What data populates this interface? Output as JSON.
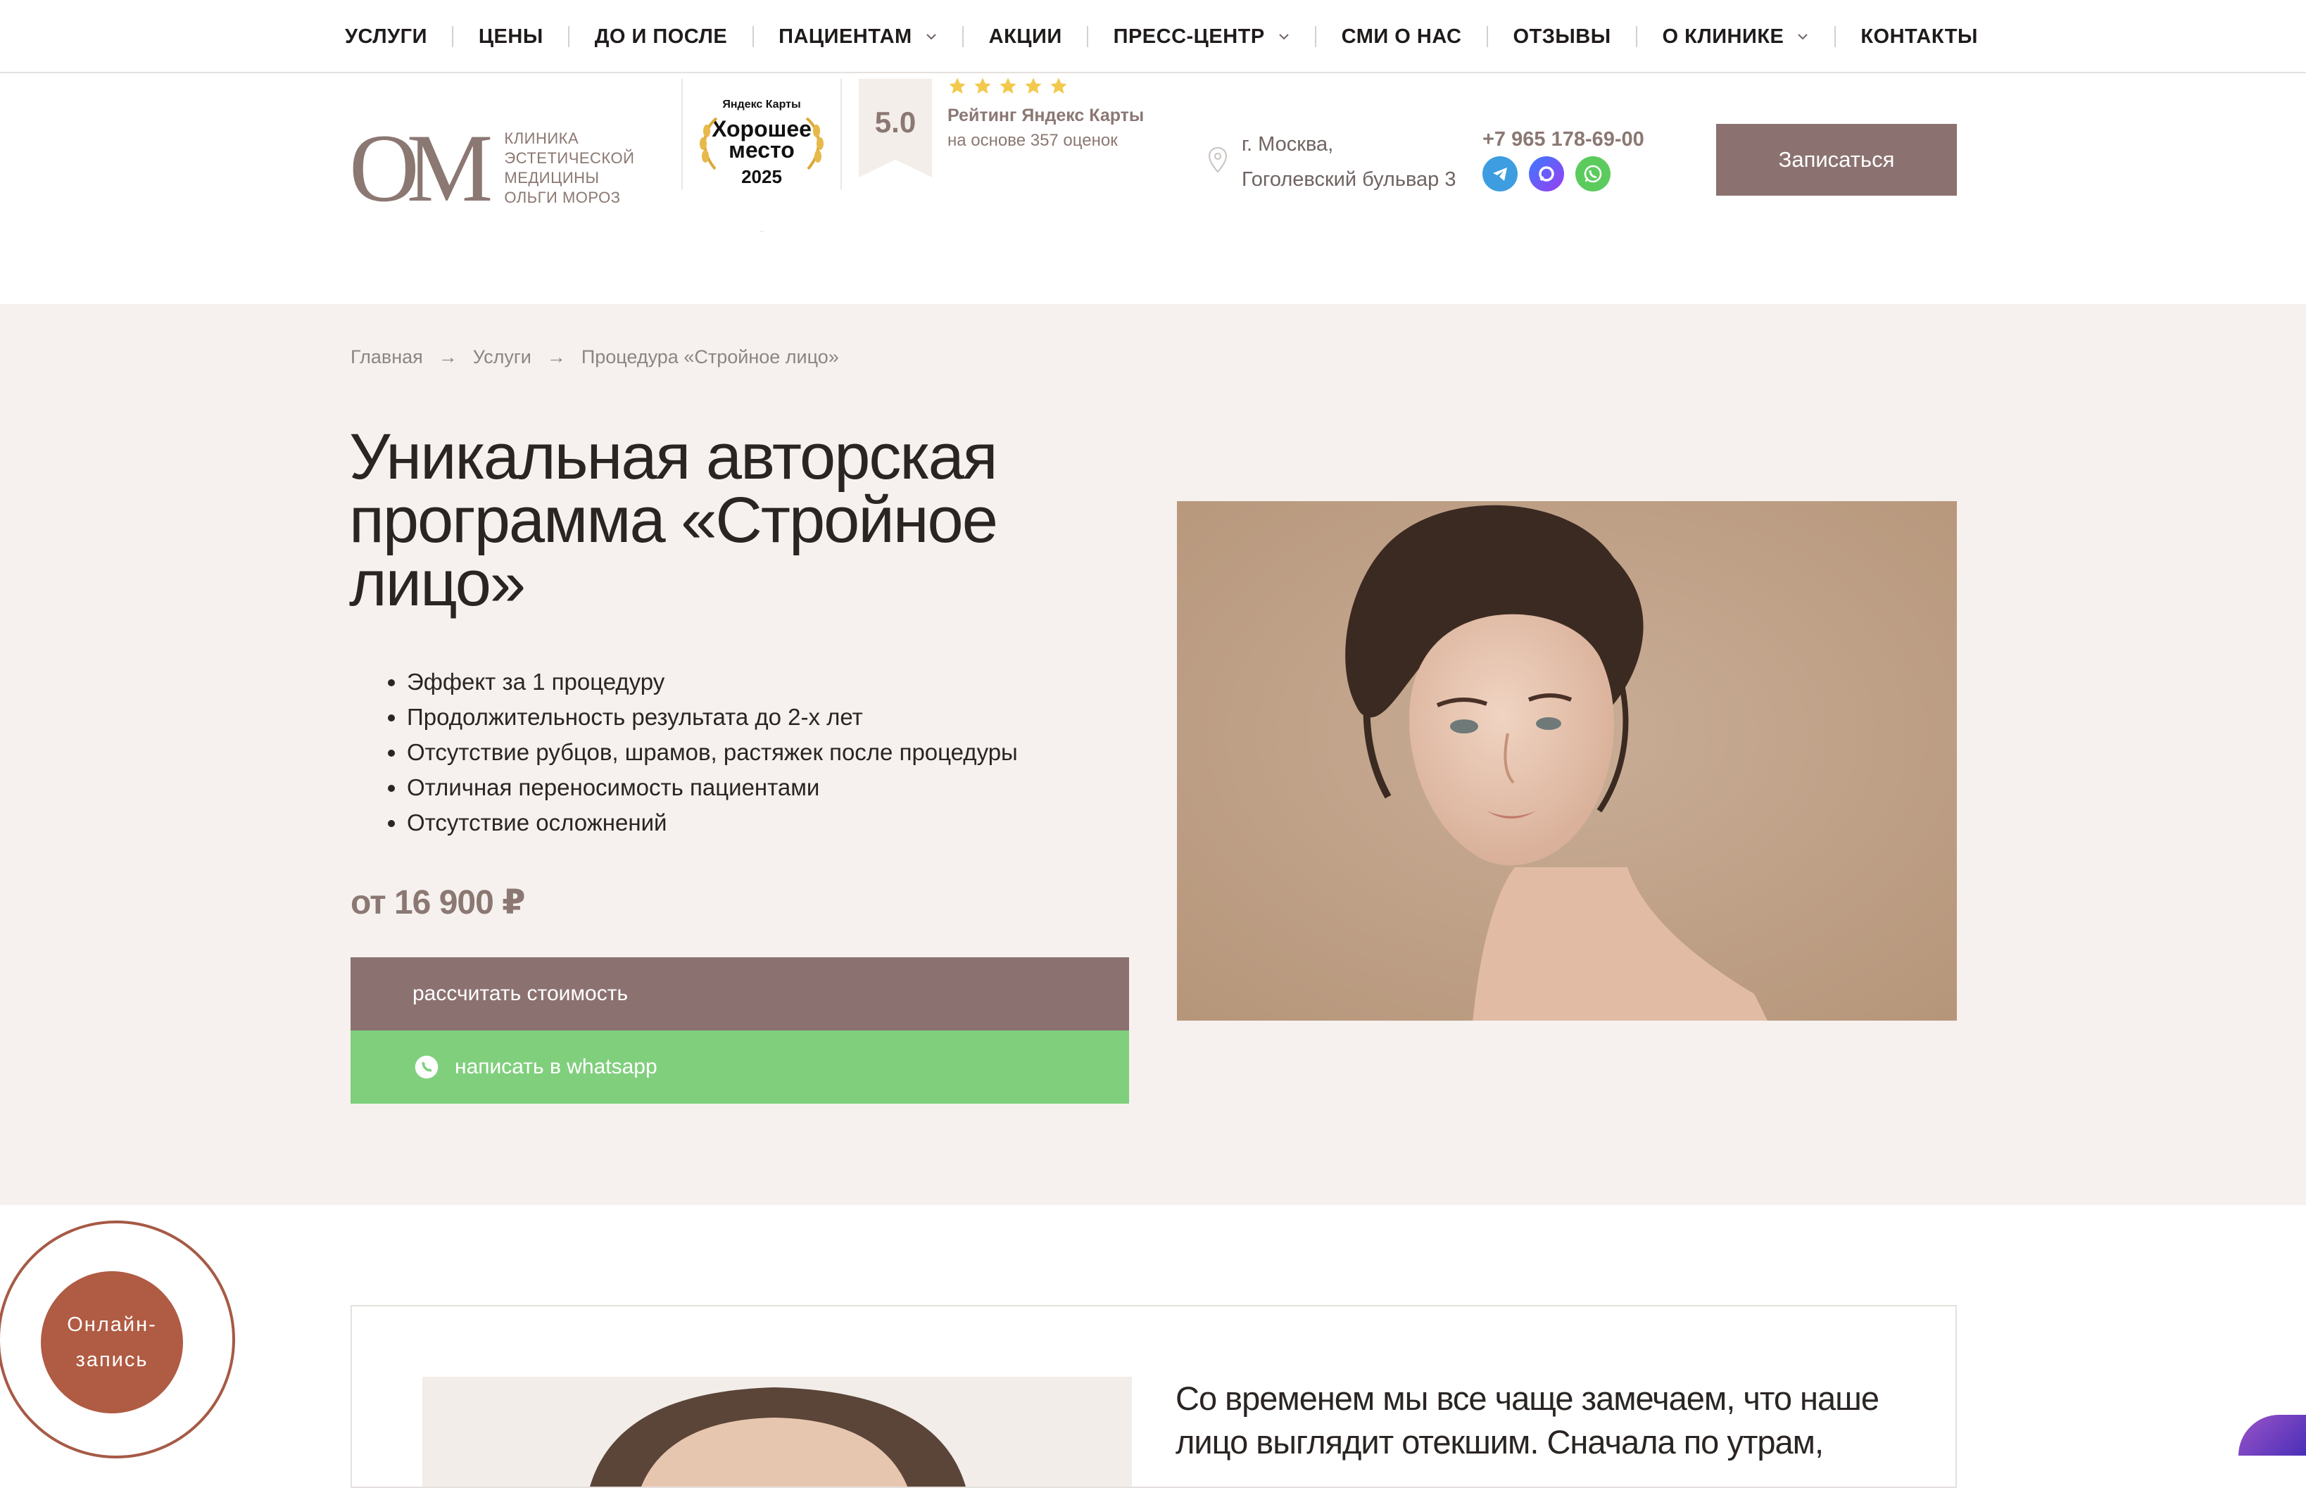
{
  "nav": {
    "items": [
      {
        "label": "УСЛУГИ",
        "dropdown": false
      },
      {
        "label": "ЦЕНЫ",
        "dropdown": false
      },
      {
        "label": "ДО И ПОСЛЕ",
        "dropdown": false
      },
      {
        "label": "ПАЦИЕНТАМ",
        "dropdown": true
      },
      {
        "label": "АКЦИИ",
        "dropdown": false
      },
      {
        "label": "ПРЕСС-ЦЕНТР",
        "dropdown": true
      },
      {
        "label": "СМИ О НАС",
        "dropdown": false
      },
      {
        "label": "ОТЗЫВЫ",
        "dropdown": false
      },
      {
        "label": "О КЛИНИКЕ",
        "dropdown": true
      },
      {
        "label": "КОНТАКТЫ",
        "dropdown": false
      }
    ]
  },
  "header": {
    "logo_mark": "OM",
    "logo_lines": [
      "КЛИНИКА",
      "ЭСТЕТИЧЕСКОЙ",
      "МЕДИЦИНЫ",
      "ОЛЬГИ МОРОЗ"
    ],
    "badge": {
      "line1": "Яндекс Карты",
      "line2": "Хорошее место",
      "line3": "2025"
    },
    "rating": {
      "score": "5.0",
      "stars": 5,
      "title": "Рейтинг Яндекс Карты",
      "subtitle": "на основе 357 оценок"
    },
    "address": {
      "line1": "г. Москва,",
      "line2": "Гоголевский бульвар 3"
    },
    "phone": "+7 965 178-69-00",
    "socials": [
      "telegram-icon",
      "max-messenger-icon",
      "whatsapp-icon"
    ],
    "cta_label": "Записаться"
  },
  "hero": {
    "breadcrumbs": [
      "Главная",
      "Услуги",
      "Процедура «Стройное лицо»"
    ],
    "title": "Уникальная авторская программа «Стройное лицо»",
    "bullets": [
      "Эффект за 1 процедуру",
      "Продолжительность результата до 2-х лет",
      "Отсутствие рубцов, шрамов, растяжек после процедуры",
      "Отличная переносимость пациентами",
      "Отсутствие осложнений"
    ],
    "price": "от 16 900 ₽",
    "calc_button": "рассчитать стоимость",
    "whatsapp_button": "написать в whatsapp"
  },
  "section2": {
    "text": "Со временем мы все чаще замечаем, что наше лицо выглядит отекшим. Сначала по утрам,"
  },
  "float_button": {
    "line1": "Онлайн-",
    "line2": "запись"
  },
  "colors": {
    "brand": "#8b7270",
    "whatsapp": "#80cf7d",
    "hero_bg": "#f6f1ee",
    "accent_orange": "#b05b43"
  }
}
